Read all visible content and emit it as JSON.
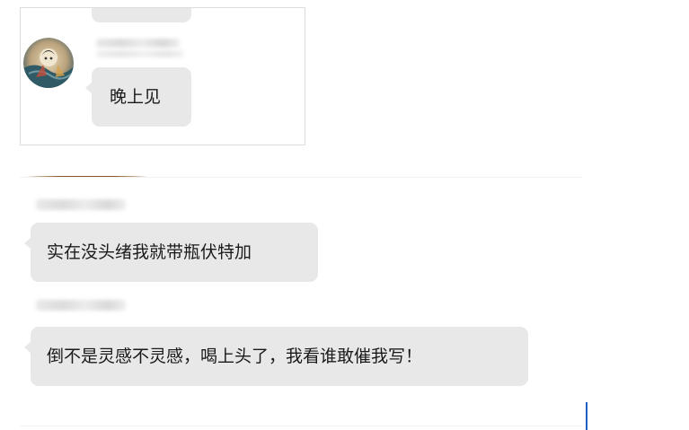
{
  "top_snippet": {
    "messages": [
      {
        "sender": "",
        "text": "晚上见"
      }
    ]
  },
  "bottom_snippet": {
    "messages": [
      {
        "sender": "",
        "text": "实在没头绪我就带瓶伏特加"
      },
      {
        "sender": "",
        "text": "倒不是灵感不灵感，喝上头了，我看谁敢催我写！"
      }
    ]
  },
  "colors": {
    "bubble_background": "#e8e8e8",
    "text": "#1a1a1a",
    "cursor": "#1f5fbf"
  },
  "icons": [
    "avatar-image",
    "text-cursor-icon"
  ]
}
